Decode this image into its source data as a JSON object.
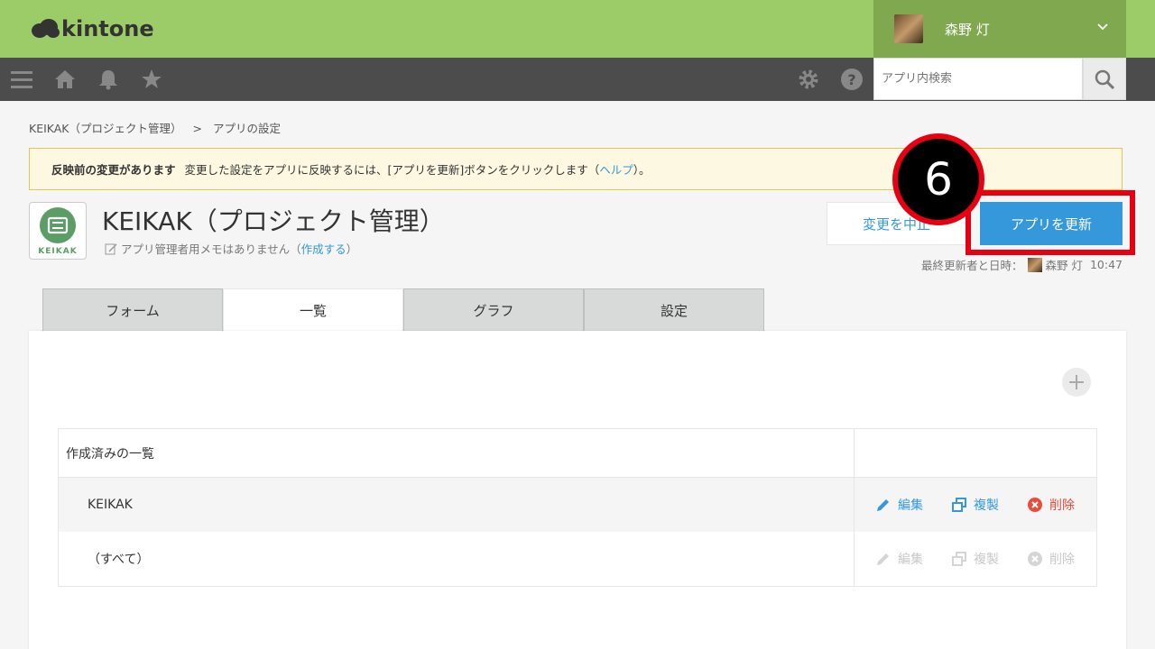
{
  "header": {
    "logo_text": "kintone",
    "user_name": "森野 灯"
  },
  "navbar": {
    "search_placeholder": "アプリ内検索"
  },
  "breadcrumb": {
    "app": "KEIKAK（プロジェクト管理）",
    "separator": ">",
    "current": "アプリの設定"
  },
  "notice": {
    "title": "反映前の変更があります",
    "message": "変更した設定をアプリに反映するには、[アプリを更新]ボタンをクリックします（",
    "help_link": "ヘルプ",
    "suffix": "）。"
  },
  "app": {
    "icon_label": "KEIKAK",
    "title": "KEIKAK（プロジェクト管理）",
    "memo": "アプリ管理者用メモはありません（",
    "memo_link": "作成する",
    "memo_suffix": "）"
  },
  "actions": {
    "cancel_label": "変更を中止",
    "update_label": "アプリを更新",
    "step_number": "6"
  },
  "last_updated": {
    "label": "最終更新者と日時：",
    "user": "森野 灯",
    "time": "10:47"
  },
  "tabs": [
    "フォーム",
    "一覧",
    "グラフ",
    "設定"
  ],
  "views": {
    "header": "作成済みの一覧",
    "rows": [
      {
        "name": "KEIKAK",
        "edit": "編集",
        "copy": "複製",
        "delete": "削除"
      },
      {
        "name": "（すべて）",
        "edit": "編集",
        "copy": "複製",
        "delete": "削除"
      }
    ]
  },
  "colors": {
    "header_green": "#9bcc67",
    "user_green": "#7fa84f",
    "navbar": "#4c4c4c",
    "primary_blue": "#3498db",
    "delete_red": "#e74c3c",
    "highlight_red": "#e60012"
  }
}
